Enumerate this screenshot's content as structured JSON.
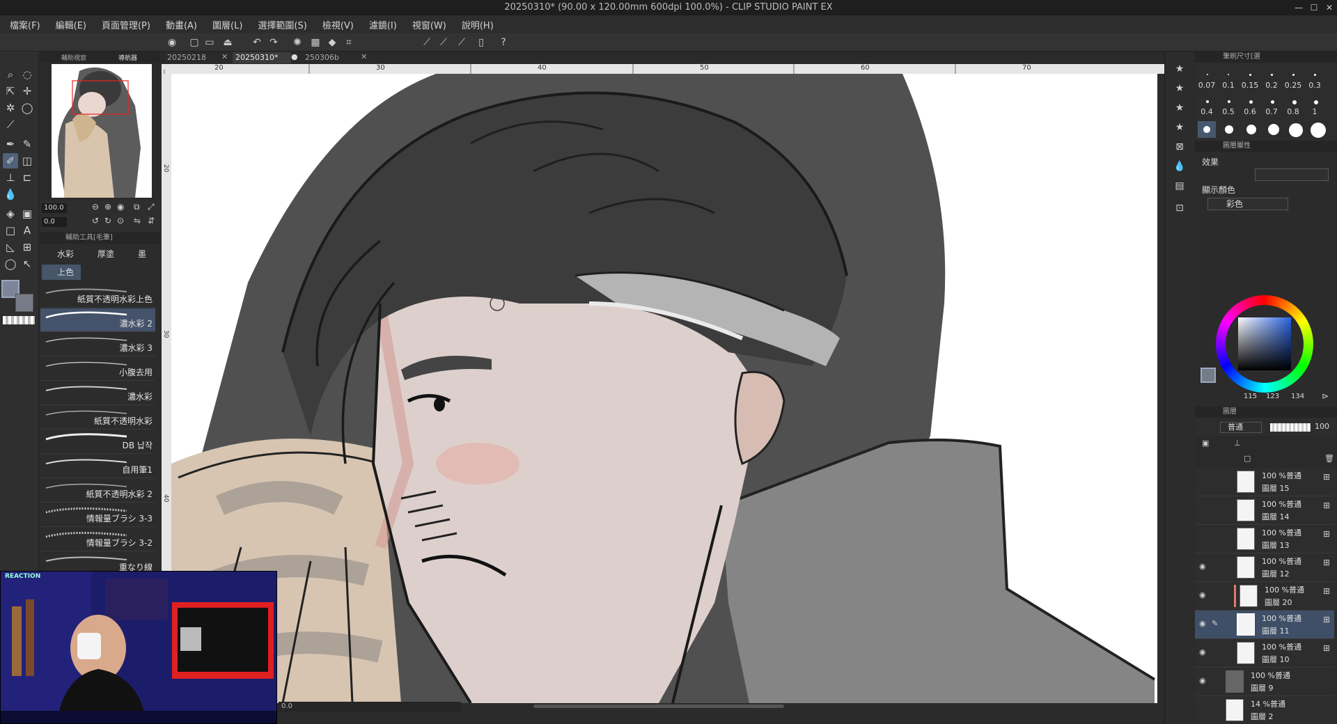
{
  "window": {
    "title": "20250310* (90.00 x 120.00mm 600dpi 100.0%) - CLIP STUDIO PAINT EX",
    "controls": [
      "—",
      "☐",
      "✕"
    ]
  },
  "menu": [
    "檔案(F)",
    "編輯(E)",
    "頁面管理(P)",
    "動畫(A)",
    "圖層(L)",
    "選擇範圍(S)",
    "檢視(V)",
    "濾鏡(I)",
    "視窗(W)",
    "說明(H)"
  ],
  "navigator": {
    "tabs": [
      "輔助視窗",
      "導航器"
    ]
  },
  "tool_property": {
    "zoom_value": "100.0",
    "angle_value": "0.0"
  },
  "subtool": {
    "header": "輔助工具[毛筆]",
    "groups": [
      "水彩",
      "厚塗",
      "墨"
    ],
    "active_group": "上色",
    "brushes": [
      "紙質不透明水彩上色",
      "濃水彩 2",
      "濃水彩 3",
      "小腹去用",
      "濃水彩",
      "紙質不透明水彩",
      "DB 납작",
      "自用筆1",
      "紙質不透明水彩 2",
      "情報量ブラシ 3-3",
      "情報量ブラシ 3-2",
      "重なり線"
    ]
  },
  "documents": {
    "tabs": [
      "20250218",
      "20250310*",
      "250306b"
    ],
    "active": "20250310*"
  },
  "ruler": {
    "top_marks": [
      "20",
      "30",
      "40",
      "50",
      "60",
      "70"
    ],
    "left_marks": [
      "20",
      "30",
      "40"
    ]
  },
  "canvas_status": {
    "zoom": "0.0"
  },
  "brush_size": {
    "header": "筆刷尺寸[選",
    "sizes": [
      "0.07",
      "0.1",
      "0.15",
      "0.2",
      "0.25",
      "0.3",
      "0.4",
      "0.5",
      "0.6",
      "0.7",
      "0.8",
      "1"
    ]
  },
  "layer_property": {
    "header": "圖層屬性",
    "effect_label": "效果",
    "display_color_label": "顯示顏色",
    "display_color_value": "彩色"
  },
  "color": {
    "r": "115",
    "g": "123",
    "b": "134",
    "main_color": "#737b86"
  },
  "layer_panel": {
    "header": "圖層",
    "blend_mode": "普通",
    "opacity": "100",
    "layers": [
      {
        "mode": "100 %普通",
        "name": "圖層 15",
        "visible": false,
        "selected": false
      },
      {
        "mode": "100 %普通",
        "name": "圖層 14",
        "visible": false,
        "selected": false
      },
      {
        "mode": "100 %普通",
        "name": "圖層 13",
        "visible": false,
        "selected": false
      },
      {
        "mode": "100 %普通",
        "name": "圖層 12",
        "visible": true,
        "selected": false
      },
      {
        "mode": "100 %普通",
        "name": "圖層 20",
        "visible": true,
        "selected": false
      },
      {
        "mode": "100 %普通",
        "name": "圖層 11",
        "visible": true,
        "selected": true
      },
      {
        "mode": "100 %普通",
        "name": "圖層 10",
        "visible": true,
        "selected": false
      },
      {
        "mode": "100 %普通",
        "name": "圖層 9",
        "visible": true,
        "selected": false
      },
      {
        "mode": "14 %普通",
        "name": "圖層 2",
        "visible": false,
        "selected": false
      }
    ]
  },
  "webcam": {
    "label": "REACTION"
  }
}
